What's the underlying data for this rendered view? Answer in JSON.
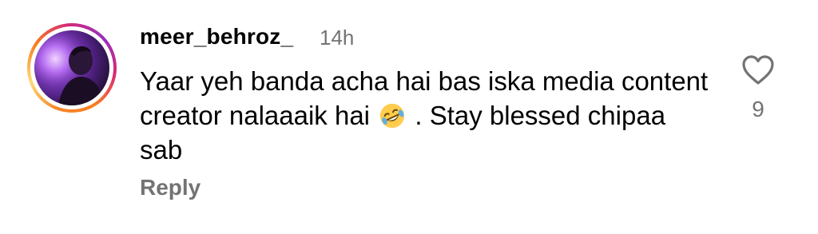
{
  "comment": {
    "username": "meer_behroz_",
    "time": "14h",
    "text_part1": "Yaar yeh banda acha hai bas iska media content creator nalaaaik hai",
    "emoji": "rolling-on-floor-laughing-emoji",
    "text_part2": ". Stay blessed chipaa sab",
    "reply_label": "Reply",
    "like_count": "9"
  },
  "icons": {
    "like": "heart-outline-icon"
  },
  "colors": {
    "secondary_text": "#737373",
    "story_ring_start": "#f58529",
    "story_ring_mid": "#d62976",
    "story_ring_end": "#962fbf"
  }
}
